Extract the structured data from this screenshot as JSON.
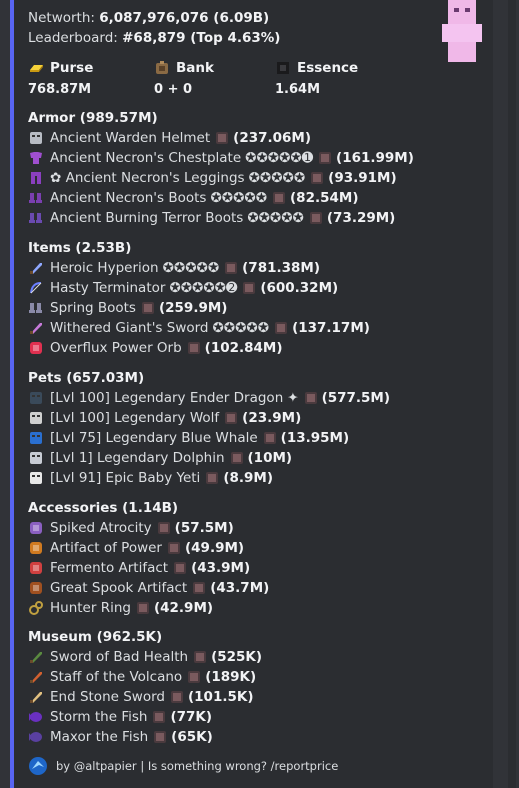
{
  "summary": {
    "networth_label": "Networth:",
    "networth_value": "6,087,976,076 (6.09B)",
    "leaderboard_label": "Leaderboard:",
    "leaderboard_value": "#68,879 (Top 4.63%)"
  },
  "stats": [
    {
      "label": "Purse",
      "value": "768.87M",
      "icon": "gold-ingot-icon"
    },
    {
      "label": "Bank",
      "value": "0 + 0",
      "icon": "bank-icon"
    },
    {
      "label": "Essence",
      "value": "1.64M",
      "icon": "essence-icon"
    }
  ],
  "sections": {
    "armor": {
      "title": "Armor (989.57M)",
      "items": [
        {
          "name": "Ancient Warden Helmet",
          "extra": "",
          "price": "(237.06M)",
          "icon": "warden-helmet-icon",
          "color": "#b8bcc4"
        },
        {
          "name": "Ancient Necron's Chestplate",
          "extra": "✪✪✪✪✪➊",
          "price": "(161.99M)",
          "icon": "chestplate-icon",
          "color": "#a04fd0"
        },
        {
          "name": "✿ Ancient Necron's Leggings",
          "extra": "✪✪✪✪✪",
          "price": "(93.91M)",
          "icon": "leggings-icon",
          "color": "#8a3fbf"
        },
        {
          "name": "Ancient Necron's Boots",
          "extra": "✪✪✪✪✪",
          "price": "(82.54M)",
          "icon": "boots-icon",
          "color": "#7a3fb0"
        },
        {
          "name": "Ancient Burning Terror Boots",
          "extra": "✪✪✪✪✪",
          "price": "(73.29M)",
          "icon": "boots-icon",
          "color": "#6a4ab0"
        }
      ]
    },
    "items": {
      "title": "Items (2.53B)",
      "items": [
        {
          "name": "Heroic Hyperion",
          "extra": "✪✪✪✪✪",
          "price": "(781.38M)",
          "icon": "sword-icon",
          "color": "#8fa8ff"
        },
        {
          "name": "Hasty Terminator",
          "extra": "✪✪✪✪✪➋",
          "price": "(600.32M)",
          "icon": "bow-icon",
          "color": "#6a7fff"
        },
        {
          "name": "Spring Boots",
          "extra": "",
          "price": "(259.9M)",
          "icon": "boots-icon",
          "color": "#8a8aa8"
        },
        {
          "name": "Withered Giant's Sword",
          "extra": "✪✪✪✪✪",
          "price": "(137.17M)",
          "icon": "sword-icon",
          "color": "#c77ad9"
        },
        {
          "name": "Overflux Power Orb",
          "extra": "",
          "price": "(102.84M)",
          "icon": "orb-icon",
          "color": "#e03050"
        }
      ]
    },
    "pets": {
      "title": "Pets (657.03M)",
      "items": [
        {
          "name": "[Lvl 100] Legendary Ender Dragon",
          "extra": "✦",
          "price": "(577.5M)",
          "icon": "dragon-icon",
          "color": "#3a4a5a"
        },
        {
          "name": "[Lvl 100] Legendary Wolf",
          "extra": "",
          "price": "(23.9M)",
          "icon": "wolf-icon",
          "color": "#d0d0d0"
        },
        {
          "name": "[Lvl 75] Legendary Blue Whale",
          "extra": "",
          "price": "(13.95M)",
          "icon": "whale-icon",
          "color": "#2a6fd0"
        },
        {
          "name": "[Lvl 1] Legendary Dolphin",
          "extra": "",
          "price": "(10M)",
          "icon": "dolphin-icon",
          "color": "#c8ccd4"
        },
        {
          "name": "[Lvl 91] Epic Baby Yeti",
          "extra": "",
          "price": "(8.9M)",
          "icon": "yeti-icon",
          "color": "#e8e8e8"
        }
      ]
    },
    "accessories": {
      "title": "Accessories (1.14B)",
      "items": [
        {
          "name": "Spiked Atrocity",
          "extra": "",
          "price": "(57.5M)",
          "icon": "atrocity-icon",
          "color": "#8a5fc0"
        },
        {
          "name": "Artifact of Power",
          "extra": "",
          "price": "(49.9M)",
          "icon": "artifact-icon",
          "color": "#d07a20"
        },
        {
          "name": "Fermento Artifact",
          "extra": "",
          "price": "(43.9M)",
          "icon": "fermento-icon",
          "color": "#d04040"
        },
        {
          "name": "Great Spook Artifact",
          "extra": "",
          "price": "(43.7M)",
          "icon": "spook-icon",
          "color": "#a05020"
        },
        {
          "name": "Hunter Ring",
          "extra": "",
          "price": "(42.9M)",
          "icon": "ring-icon",
          "color": "#c0a040"
        }
      ]
    },
    "museum": {
      "title": "Museum (962.5K)",
      "items": [
        {
          "name": "Sword of Bad Health",
          "extra": "",
          "price": "(525K)",
          "icon": "sword-icon",
          "color": "#5a8a40"
        },
        {
          "name": "Staff of the Volcano",
          "extra": "",
          "price": "(189K)",
          "icon": "staff-icon",
          "color": "#d06030"
        },
        {
          "name": "End Stone Sword",
          "extra": "",
          "price": "(101.5K)",
          "icon": "sword-icon",
          "color": "#e0c080"
        },
        {
          "name": "Storm the Fish",
          "extra": "",
          "price": "(77K)",
          "icon": "fish-icon",
          "color": "#6a30c0"
        },
        {
          "name": "Maxor the Fish",
          "extra": "",
          "price": "(65K)",
          "icon": "fish-icon",
          "color": "#5a40a0"
        }
      ]
    }
  },
  "footer": {
    "text": "by @altpapier | Is something wrong? /reportprice",
    "icon": "bot-avatar-icon"
  }
}
